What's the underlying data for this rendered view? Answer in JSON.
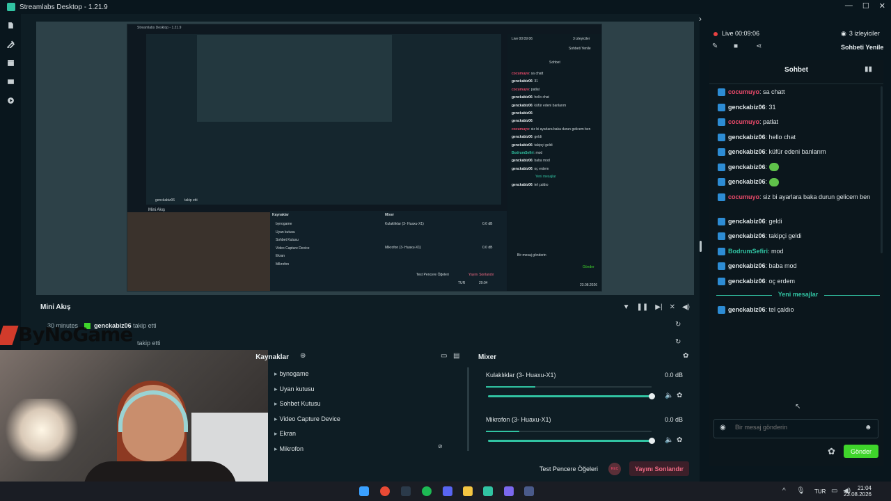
{
  "window": {
    "title": "Streamlabs Desktop - 1.21.9",
    "minimize": "—",
    "maximize": "☐",
    "close": "✕"
  },
  "screen": {
    "title": "Streamlabs Desktop - 1.21.9",
    "mini_label": "Mini Akış",
    "chat_lines": [
      {
        "user": "cocumuyo",
        "text": "sa chatt",
        "color": "red"
      },
      {
        "user": "genckabiz06",
        "text": "31"
      },
      {
        "user": "cocumuyo",
        "text": "patlat",
        "color": "red"
      },
      {
        "user": "genckabiz06",
        "text": "hello chat"
      },
      {
        "user": "genckabiz06",
        "text": "küfür edeni banlarım"
      },
      {
        "user": "genckabiz06",
        "text": ""
      },
      {
        "user": "genckabiz06",
        "text": ""
      },
      {
        "user": "cocumuyo",
        "text": "siz bi ayarlara baka durun gelicem ben",
        "color": "red"
      },
      {
        "user": "genckabiz06",
        "text": "geldi"
      },
      {
        "user": "genckabiz06",
        "text": "takipçi geldi"
      },
      {
        "user": "BodrumSefiri",
        "text": "mod",
        "color": "teal"
      },
      {
        "user": "genckabiz06",
        "text": "baba mod"
      },
      {
        "user": "genckabiz06",
        "text": "oç erdem"
      },
      {
        "user": "",
        "text": "Yeni mesajlar"
      },
      {
        "user": "genckabiz06",
        "text": "tel çaldıo"
      }
    ],
    "sources_tiny": [
      "bynogame",
      "Uyan kutusu",
      "Sohbet Kutusu",
      "Video Capture Device",
      "Ekran",
      "Mikrofon"
    ],
    "mixer_tiny": [
      "Kulaklıklar (3- Huaxu-X1)",
      "Mikrofon (3- Huaxu-X1)"
    ],
    "db": "0.0 dB",
    "footer_test": "Test Pencere Öğeleri",
    "footer_end": "Yayını Sonlandır",
    "input_placeholder": "Bir mesaj gönderin",
    "send": "Gönder",
    "live": "Live 00:09:06",
    "viewers": "3 izleyiciler",
    "refresh": "Sohbeti Yenile",
    "chat_title": "Sohbet",
    "time": "20:04",
    "date": "23.08.2026",
    "lang": "TUR",
    "follow_user": "genckabiz06",
    "follow_text": "takip etti"
  },
  "mini_feed": {
    "title": "Mini Akış",
    "items": [
      {
        "time": "30 minutes",
        "user": "genckabiz06",
        "action": "takip etti"
      },
      {
        "time": "",
        "user": "",
        "action": "takip etti"
      }
    ]
  },
  "watermark": "ByNoGame",
  "sources": {
    "title": "Kaynaklar",
    "items": [
      "bynogame",
      "Uyan kutusu",
      "Sohbet Kutusu",
      "Video Capture Device",
      "Ekran",
      "Mikrofon"
    ]
  },
  "mixer": {
    "title": "Mixer",
    "channels": [
      {
        "name": "Kulaklıklar (3- Huaxu-X1)",
        "db": "0.0 dB",
        "level": 1.0
      },
      {
        "name": "Mikrofon (3- Huaxu-X1)",
        "db": "0.0 dB",
        "level": 1.0
      }
    ]
  },
  "footer": {
    "test": "Test Pencere Öğeleri",
    "rec": "REC",
    "end": "Yayını Sonlandır"
  },
  "chat": {
    "live": "Live 00:09:06",
    "viewers": "3 izleyiciler",
    "refresh": "Sohbeti Yenile",
    "title": "Sohbet",
    "new_messages": "Yeni mesajlar",
    "messages": [
      {
        "user": "cocumuyo",
        "text": ": sa chatt",
        "color": "red"
      },
      {
        "user": "genckabiz06",
        "text": ": 31",
        "color": "white"
      },
      {
        "user": "cocumuyo",
        "text": ": patlat",
        "color": "red"
      },
      {
        "user": "genckabiz06",
        "text": ": hello chat",
        "color": "white"
      },
      {
        "user": "genckabiz06",
        "text": ": küfür edeni banlarım",
        "color": "white"
      },
      {
        "user": "genckabiz06",
        "text": ":",
        "color": "white",
        "emote": "emote-face"
      },
      {
        "user": "genckabiz06",
        "text": ":",
        "color": "white",
        "emote": "emote-face"
      },
      {
        "user": "cocumuyo",
        "text": ": siz bi ayarlara baka durun gelicem ben",
        "color": "red"
      },
      {
        "user": "genckabiz06",
        "text": ": geldi",
        "color": "white"
      },
      {
        "user": "genckabiz06",
        "text": ": takipçi geldi",
        "color": "white"
      },
      {
        "user": "BodrumSefiri",
        "text": ": mod",
        "color": "teal"
      },
      {
        "user": "genckabiz06",
        "text": ": baba mod",
        "color": "white"
      },
      {
        "user": "genckabiz06",
        "text": ": oç erdem",
        "color": "white"
      }
    ],
    "after_new": [
      {
        "user": "genckabiz06",
        "text": ": tel çaldıo",
        "color": "white"
      }
    ],
    "input_placeholder": "Bir mesaj gönderin",
    "send": "Gönder"
  },
  "taskbar": {
    "lang": "TUR",
    "time": "21:04",
    "date": "23.08.2026"
  },
  "colors": {
    "accent": "#31c3a2",
    "danger": "#ea4a6a",
    "send": "#3fd52b",
    "bg": "#09161d"
  }
}
